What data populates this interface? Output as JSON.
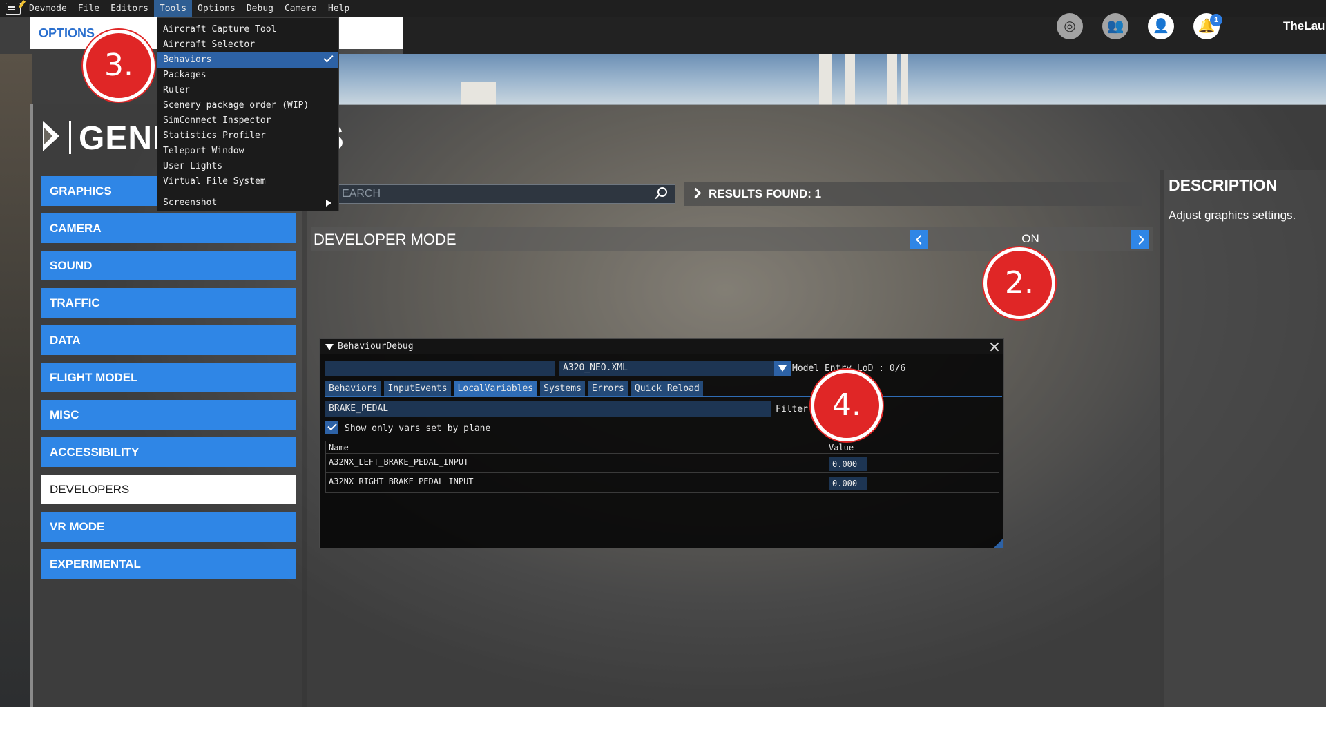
{
  "menubar": {
    "items": [
      "Devmode",
      "File",
      "Editors",
      "Tools",
      "Options",
      "Debug",
      "Camera",
      "Help"
    ],
    "active": "Tools"
  },
  "tools_menu": {
    "items": [
      "Aircraft Capture Tool",
      "Aircraft Selector",
      "Behaviors",
      "Packages",
      "Ruler",
      "Scenery package order (WIP)",
      "SimConnect Inspector",
      "Statistics Profiler",
      "Teleport Window",
      "User Lights",
      "Virtual File System"
    ],
    "checked_item": "Behaviors",
    "submenu_item": "Screenshot"
  },
  "header": {
    "options_tab": "OPTIONS",
    "page_title": "GENE",
    "page_title_tail": "NS",
    "notification_count": "1",
    "username": "TheLau"
  },
  "sidebar": {
    "items": [
      "GRAPHICS",
      "CAMERA",
      "SOUND",
      "TRAFFIC",
      "DATA",
      "FLIGHT MODEL",
      "MISC",
      "ACCESSIBILITY",
      "DEVELOPERS",
      "VR MODE",
      "EXPERIMENTAL"
    ],
    "selected": "DEVELOPERS"
  },
  "search": {
    "placeholder": "EARCH",
    "results_label": "RESULTS FOUND: 1"
  },
  "setting": {
    "label": "DEVELOPER MODE",
    "value": "ON"
  },
  "description": {
    "title": "DESCRIPTION",
    "text": "Adjust graphics settings."
  },
  "annotations": [
    "3.",
    "2.",
    "4."
  ],
  "behaviour_debug": {
    "title": "BehaviourDebug",
    "file": "A320_NEO.XML",
    "lod_label": "Model Entry LoD : 0/6",
    "tabs": [
      "Behaviors",
      "InputEvents",
      "LocalVariables",
      "Systems",
      "Errors",
      "Quick Reload"
    ],
    "active_tab": "LocalVariables",
    "filter_value": "BRAKE_PEDAL",
    "filter_label": "Filter",
    "show_only_label": "Show only vars set by plane",
    "show_only_checked": true,
    "table": {
      "headers": [
        "Name",
        "Value"
      ],
      "rows": [
        {
          "name": "A32NX_LEFT_BRAKE_PEDAL_INPUT",
          "value": "0.000"
        },
        {
          "name": "A32NX_RIGHT_BRAKE_PEDAL_INPUT",
          "value": "0.000"
        }
      ]
    }
  },
  "colors": {
    "accent_blue": "#2f86e6",
    "annotation_red": "#e02626",
    "menu_highlight": "#2d62a6"
  }
}
